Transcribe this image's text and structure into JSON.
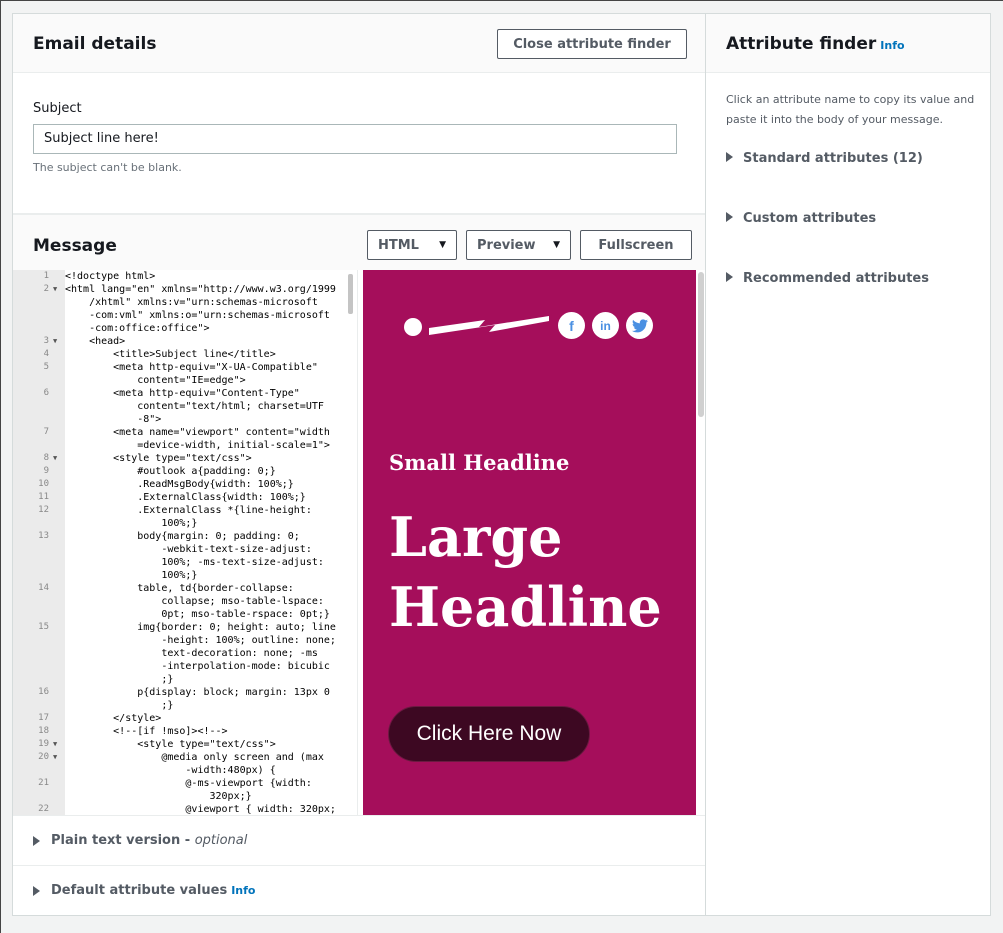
{
  "email_details": {
    "title": "Email details",
    "close_button": "Close attribute finder",
    "subject_label": "Subject",
    "subject_value": "Subject line here!",
    "subject_hint": "The subject can't be blank."
  },
  "message": {
    "title": "Message",
    "html_button": "HTML",
    "preview_button": "Preview",
    "fullscreen_button": "Fullscreen"
  },
  "code_lines": [
    {
      "n": "1",
      "fold": "",
      "t": "<!doctype html>"
    },
    {
      "n": "2",
      "fold": "▼",
      "t": "<html lang=\"en\" xmlns=\"http://www.w3.org/1999"
    },
    {
      "n": "",
      "fold": "",
      "t": "    /xhtml\" xmlns:v=\"urn:schemas-microsoft"
    },
    {
      "n": "",
      "fold": "",
      "t": "    -com:vml\" xmlns:o=\"urn:schemas-microsoft"
    },
    {
      "n": "",
      "fold": "",
      "t": "    -com:office:office\">"
    },
    {
      "n": "3",
      "fold": "▼",
      "t": "    <head>"
    },
    {
      "n": "4",
      "fold": "",
      "t": "        <title>Subject line</title>"
    },
    {
      "n": "5",
      "fold": "",
      "t": "        <meta http-equiv=\"X-UA-Compatible\""
    },
    {
      "n": "",
      "fold": "",
      "t": "            content=\"IE=edge\">"
    },
    {
      "n": "6",
      "fold": "",
      "t": "        <meta http-equiv=\"Content-Type\""
    },
    {
      "n": "",
      "fold": "",
      "t": "            content=\"text/html; charset=UTF"
    },
    {
      "n": "",
      "fold": "",
      "t": "            -8\">"
    },
    {
      "n": "7",
      "fold": "",
      "t": "        <meta name=\"viewport\" content=\"width"
    },
    {
      "n": "",
      "fold": "",
      "t": "            =device-width, initial-scale=1\">"
    },
    {
      "n": "8",
      "fold": "▼",
      "t": "        <style type=\"text/css\">"
    },
    {
      "n": "9",
      "fold": "",
      "t": "            #outlook a{padding: 0;}"
    },
    {
      "n": "10",
      "fold": "",
      "t": "            .ReadMsgBody{width: 100%;}"
    },
    {
      "n": "11",
      "fold": "",
      "t": "            .ExternalClass{width: 100%;}"
    },
    {
      "n": "12",
      "fold": "",
      "t": "            .ExternalClass *{line-height:"
    },
    {
      "n": "",
      "fold": "",
      "t": "                100%;}"
    },
    {
      "n": "13",
      "fold": "",
      "t": "            body{margin: 0; padding: 0;"
    },
    {
      "n": "",
      "fold": "",
      "t": "                -webkit-text-size-adjust:"
    },
    {
      "n": "",
      "fold": "",
      "t": "                100%; -ms-text-size-adjust:"
    },
    {
      "n": "",
      "fold": "",
      "t": "                100%;}"
    },
    {
      "n": "14",
      "fold": "",
      "t": "            table, td{border-collapse:"
    },
    {
      "n": "",
      "fold": "",
      "t": "                collapse; mso-table-lspace:"
    },
    {
      "n": "",
      "fold": "",
      "t": "                0pt; mso-table-rspace: 0pt;}"
    },
    {
      "n": "15",
      "fold": "",
      "t": "            img{border: 0; height: auto; line"
    },
    {
      "n": "",
      "fold": "",
      "t": "                -height: 100%; outline: none;"
    },
    {
      "n": "",
      "fold": "",
      "t": "                text-decoration: none; -ms"
    },
    {
      "n": "",
      "fold": "",
      "t": "                -interpolation-mode: bicubic"
    },
    {
      "n": "",
      "fold": "",
      "t": "                ;}"
    },
    {
      "n": "16",
      "fold": "",
      "t": "            p{display: block; margin: 13px 0"
    },
    {
      "n": "",
      "fold": "",
      "t": "                ;}"
    },
    {
      "n": "17",
      "fold": "",
      "t": "        </style>"
    },
    {
      "n": "18",
      "fold": "",
      "t": "        <!--[if !mso]><!-->"
    },
    {
      "n": "19",
      "fold": "▼",
      "t": "            <style type=\"text/css\">"
    },
    {
      "n": "20",
      "fold": "▼",
      "t": "                @media only screen and (max"
    },
    {
      "n": "",
      "fold": "",
      "t": "                    -width:480px) {"
    },
    {
      "n": "21",
      "fold": "",
      "t": "                    @-ms-viewport {width:"
    },
    {
      "n": "",
      "fold": "",
      "t": "                        320px;}"
    },
    {
      "n": "22",
      "fold": "",
      "t": "                    @viewport { width: 320px;"
    }
  ],
  "preview": {
    "small_headline": "Small Headline",
    "large_headline_1": "Large",
    "large_headline_2": "Headline",
    "cta_label": "Click Here Now",
    "social": {
      "facebook": "f",
      "linkedin": "in"
    },
    "colors": {
      "background": "#a50e5b",
      "cta": "#3d0822"
    }
  },
  "sections": {
    "plain_text_label": "Plain text version - ",
    "plain_text_optional": "optional",
    "default_attr_label": "Default attribute values",
    "info": "Info"
  },
  "attribute_finder": {
    "title": "Attribute finder",
    "info": "Info",
    "description": "Click an attribute name to copy its value and paste it into the body of your message.",
    "items": [
      "Standard attributes (12)",
      "Custom attributes",
      "Recommended attributes"
    ]
  }
}
